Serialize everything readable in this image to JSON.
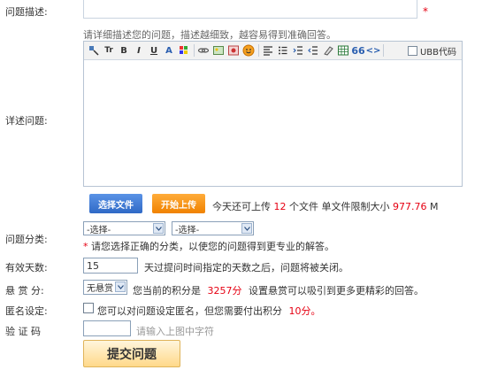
{
  "labels": {
    "desc": "问题描述:",
    "detail": "详述问题:",
    "category": "问题分类:",
    "days": "有效天数:",
    "reward": "悬 赏 分:",
    "anonymous": "匿名设定:",
    "captcha": "验 证 码"
  },
  "desc": {
    "required_mark": "*"
  },
  "detail": {
    "hint": "请详细描述您的问题，描述越细致，越容易得到准确回答。",
    "toolbar_icons": [
      "format-icon",
      "font-size-icon",
      "bold-icon",
      "italic-icon",
      "underline-icon",
      "font-name-icon",
      "color-icon",
      "link-icon",
      "image-icon",
      "media-icon",
      "emoticon-icon",
      "align-left-icon",
      "list-icon",
      "indent-icon",
      "outdent-icon",
      "clear-format-icon",
      "table-icon",
      "quote-icon",
      "code-icon"
    ],
    "ubb_label": "UBB代码"
  },
  "upload": {
    "choose_label": "选择文件",
    "start_label": "开始上传",
    "info_prefix": "今天还可上传",
    "count": "12",
    "info_mid": "个文件 单文件限制大小",
    "size": "977.76",
    "unit": "M"
  },
  "category": {
    "select1": "-选择-",
    "select2": "-选择-",
    "note_mark": "*",
    "note": "请您选择正确的分类，以使您的问题得到更专业的解答。"
  },
  "days": {
    "value": "15",
    "note": "天过提问时间指定的天数之后，问题将被关闭。"
  },
  "reward": {
    "selected": "无悬赏",
    "note_prefix": "您当前的积分是",
    "points": "3257分",
    "note_suffix": "设置悬赏可以吸引到更多更精彩的回答。"
  },
  "anonymous": {
    "note": "您可以对问题设定匿名，但您需要付出积分",
    "cost": "10分。"
  },
  "captcha": {
    "placeholder": "请输入上图中字符"
  },
  "submit_label": "提交问题"
}
